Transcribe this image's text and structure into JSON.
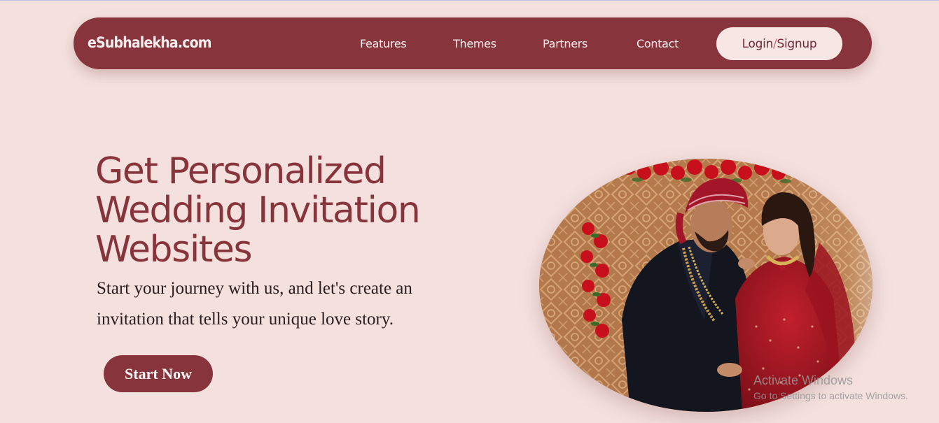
{
  "navbar": {
    "brand": "eSubhalekha.com",
    "links": [
      "Features",
      "Themes",
      "Partners",
      "Contact"
    ],
    "login_part1": "Login",
    "login_slash": "/",
    "login_part2": "Signup"
  },
  "hero": {
    "title_line1": "Get Personalized",
    "title_line2": "Wedding Invitation",
    "title_line3": "Websites",
    "subtitle": "Start your journey with us, and let's create an invitation that tells your unique love story.",
    "cta_label": "Start Now",
    "image_icon": "couple-photo"
  },
  "watermark": {
    "title": "Activate Windows",
    "subtitle": "Go to Settings to activate Windows."
  },
  "colors": {
    "background": "#f4e1de",
    "brand": "#88343c",
    "button_light": "#f7e6e4"
  }
}
